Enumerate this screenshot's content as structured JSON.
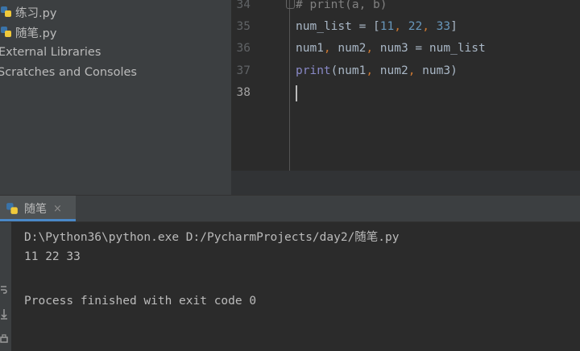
{
  "project_tree": {
    "items": [
      {
        "label": "练习.py",
        "icon": "python-file-icon"
      },
      {
        "label": "随笔.py",
        "icon": "python-file-icon"
      },
      {
        "label": "External Libraries",
        "icon": ""
      },
      {
        "label": "Scratches and Consoles",
        "icon": ""
      }
    ]
  },
  "editor": {
    "line_numbers": [
      "34",
      "35",
      "36",
      "37",
      "38"
    ],
    "lines": {
      "l34": {
        "comment": "# print(a, b)"
      },
      "l35": {
        "var": "num_list",
        "eq": " = ",
        "lb": "[",
        "n1": "11",
        "c1": ", ",
        "n2": "22",
        "c2": ", ",
        "n3": "33",
        "rb": "]"
      },
      "l36": {
        "a": "num1",
        "c1": ", ",
        "b": "num2",
        "c2": ", ",
        "c": "num3",
        "eq": " = ",
        "d": "num_list"
      },
      "l37": {
        "fn": "print",
        "lp": "(",
        "a": "num1",
        "c1": ", ",
        "b": "num2",
        "c2": ", ",
        "c": "num3",
        "rp": ")"
      }
    }
  },
  "run_panel": {
    "tab_label": "随笔",
    "tab_close": "×",
    "console_lines": [
      "D:\\Python36\\python.exe D:/PycharmProjects/day2/随笔.py",
      "11 22 33",
      "",
      "Process finished with exit code 0"
    ]
  },
  "colors": {
    "accent": "#4a88c7",
    "panel_bg": "#3c3f41",
    "editor_bg": "#2b2b2b"
  }
}
